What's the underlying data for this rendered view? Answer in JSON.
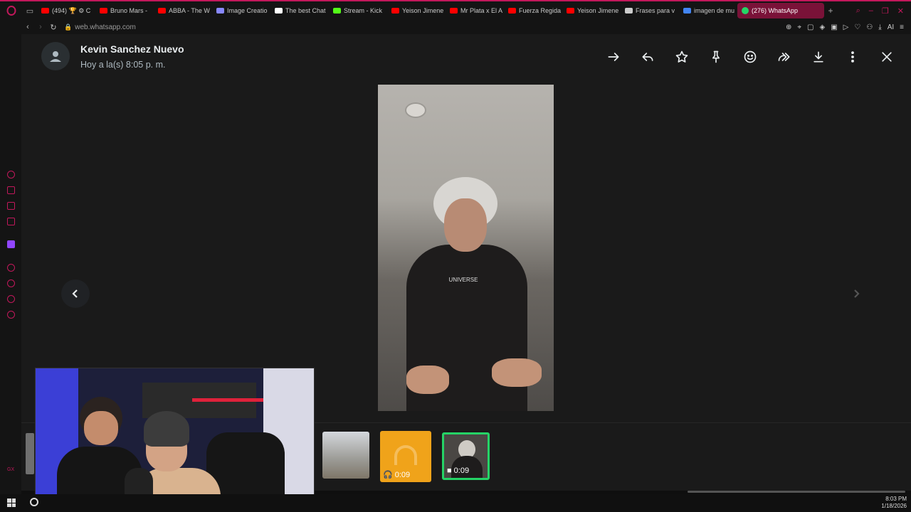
{
  "browser": {
    "tabs": [
      {
        "label": "(494) 🏆 ⚙ C",
        "favicon_color": "#ff0000"
      },
      {
        "label": "Bruno Mars -",
        "favicon_color": "#ff0000"
      },
      {
        "label": "ABBA - The W",
        "favicon_color": "#ff0000"
      },
      {
        "label": "Image Creatio",
        "favicon_color": "#8888ff"
      },
      {
        "label": "The best Chat",
        "favicon_color": "#ffffff"
      },
      {
        "label": "Stream - Kick",
        "favicon_color": "#53fc18"
      },
      {
        "label": "Yeison Jimene",
        "favicon_color": "#ff0000"
      },
      {
        "label": "Mr Plata x El A",
        "favicon_color": "#ff0000"
      },
      {
        "label": "Fuerza Regida",
        "favicon_color": "#ff0000"
      },
      {
        "label": "Yeison Jimene",
        "favicon_color": "#ff0000"
      },
      {
        "label": "Frases para v",
        "favicon_color": "#cccccc"
      },
      {
        "label": "imagen de mu",
        "favicon_color": "#4285f4"
      }
    ],
    "active_tab": {
      "label": "(276) WhatsApp",
      "favicon_color": "#25d366"
    },
    "new_tab": "+",
    "url": "web.whatsapp.com",
    "ai_label": "AI"
  },
  "viewer": {
    "contact_name": "Kevin Sanchez Nuevo",
    "timestamp": "Hoy a la(s) 8:05 p. m.",
    "media_logo_text": "UNIVERSE",
    "actions": [
      "forward-arrow",
      "reply",
      "star",
      "pin",
      "emoji",
      "share",
      "download",
      "menu",
      "close"
    ],
    "thumbnails": [
      {
        "type": "image",
        "duration": ""
      },
      {
        "type": "audio",
        "duration": "0:09"
      },
      {
        "type": "video",
        "duration": "0:09",
        "selected": true
      }
    ],
    "accent_color": "#25d366"
  },
  "taskbar": {
    "time": "8:03 PM",
    "date": "1/18/2026"
  },
  "sidebar": {
    "gx_label": "GX"
  }
}
